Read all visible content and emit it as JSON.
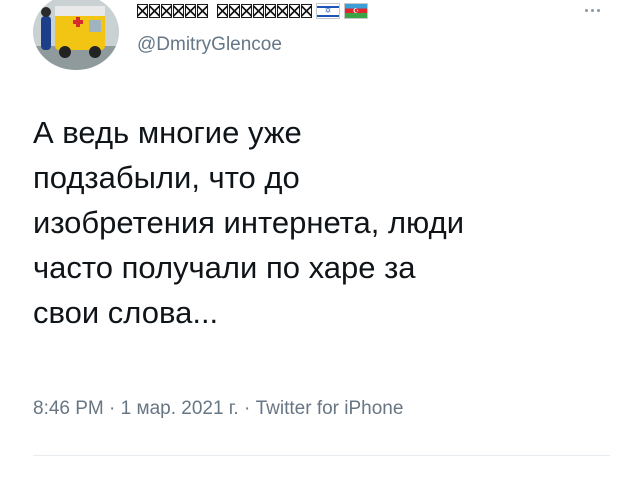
{
  "user": {
    "handle": "@DmitryGlencoe",
    "flags": [
      "israel-flag",
      "azerbaijan-flag"
    ]
  },
  "tweet": {
    "lines": [
      "А ведь многие уже",
      "подзабыли, что до",
      "изобретения интернета, люди",
      "часто получали по харе за",
      "свои слова..."
    ],
    "time": "8:46 PM",
    "date": "1 мар. 2021 г.",
    "source": "Twitter for iPhone",
    "separator": "·"
  },
  "icons": {
    "more": "more-horizontal-icon"
  },
  "colors": {
    "text": "#0f1419",
    "secondary": "#657786",
    "divider": "#e6ecf0"
  }
}
